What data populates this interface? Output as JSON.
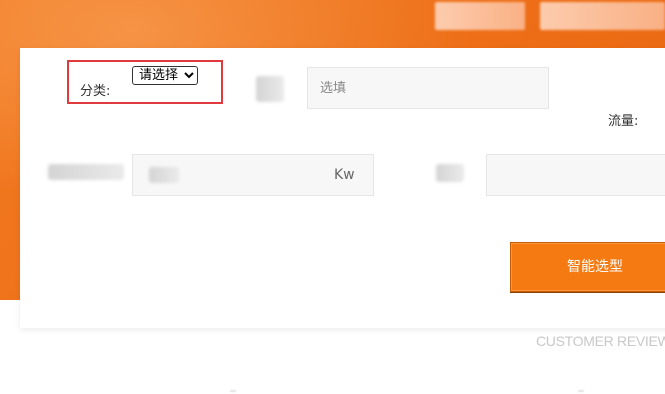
{
  "form": {
    "category_label": "分类:",
    "category_select_value": "请选择",
    "category_options": [
      "请选择"
    ],
    "option_placeholder": "选填",
    "flow_label": "流量:",
    "power_unit": "Kw",
    "submit_label": "智能选型"
  },
  "footer": {
    "section_heading": "CUSTOMER REVIEW"
  },
  "colors": {
    "brand_orange": "#f47a11",
    "highlight_red": "#e0393e"
  }
}
